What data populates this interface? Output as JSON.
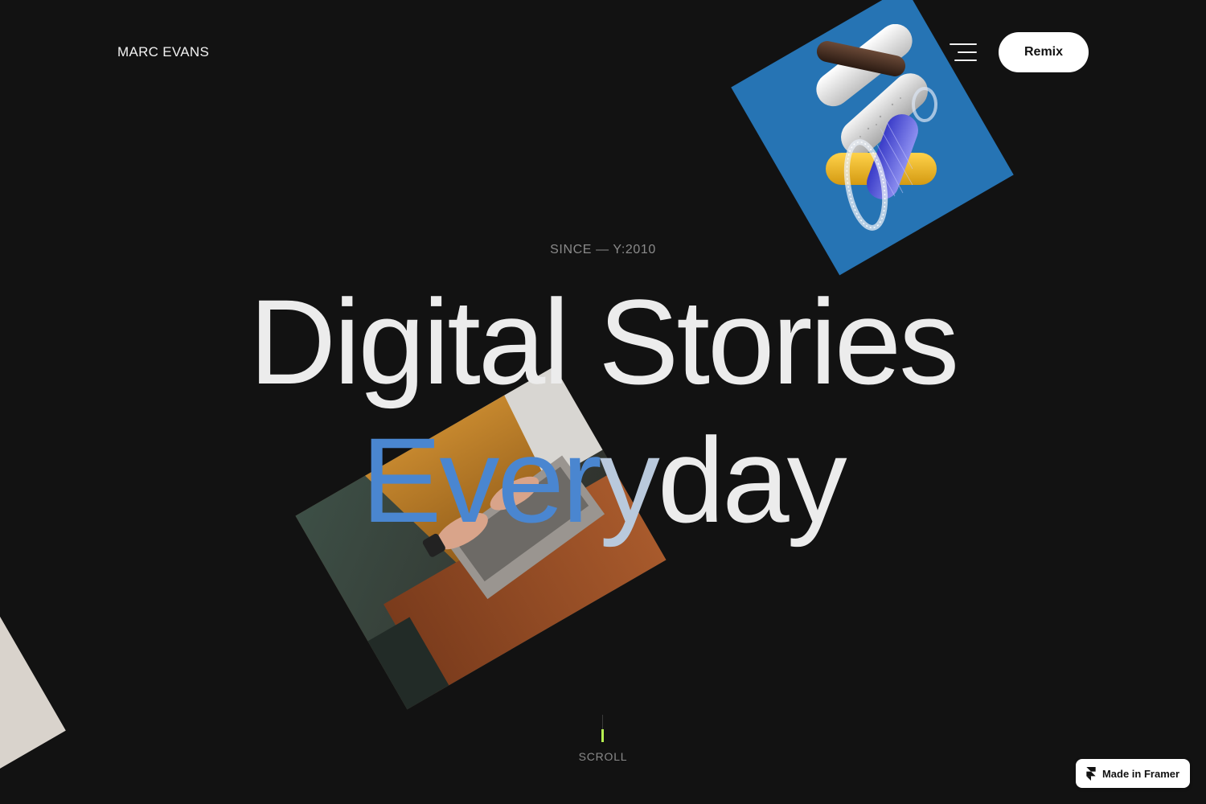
{
  "header": {
    "brand": "MARC EVANS",
    "menu_icon": "hamburger-menu-icon",
    "remix_label": "Remix"
  },
  "hero": {
    "eyebrow": "SINCE — Y:2010",
    "line1": "Digital Stories",
    "line2_highlight": "Ever",
    "line2_soft": "y",
    "line2_rest": "day"
  },
  "scroll": {
    "label": "SCROLL"
  },
  "badge": {
    "label": "Made in Framer",
    "icon": "framer-logo-icon"
  },
  "colors": {
    "background": "#121212",
    "card_blue": "#2674b4",
    "scroll_accent": "#b6f050",
    "highlight_blue": "#4a86d0"
  }
}
